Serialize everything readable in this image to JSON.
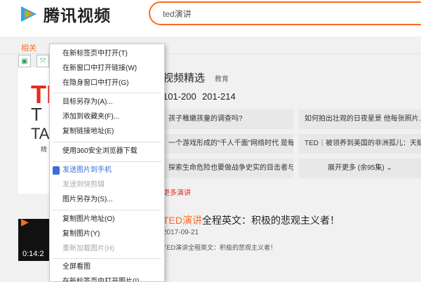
{
  "header": {
    "logo_text": "腾讯视频",
    "search_value": "ted演讲"
  },
  "breadcrumb": "相关",
  "card": {
    "letters_red": "TE",
    "letters_dark": "T",
    "letters_dark2": "TA",
    "small_text": "精"
  },
  "section": {
    "title": "视频精选",
    "tag": "教育",
    "ranges": [
      "101-200",
      "201-214"
    ],
    "tiles": [
      [
        "孩子稚嫩孩童的调查吗?",
        "如何拍出壮观的日夜星景 他每张照片..."
      ],
      [
        "一个游戏形成的\"千人千面\"网络时代 是每个人...",
        "TED｜被领养到美国的非洲孤儿：天赋..."
      ],
      [
        "探索生命危险也要做战争史实的目击者与中...",
        ""
      ]
    ],
    "expand_label": "展开更多 (余95集)",
    "red_link": "更多演讲"
  },
  "video": {
    "time": "0:14:2",
    "title_highlight": "TED演讲",
    "title_rest": "全程英文：积极的悲观主义者！",
    "date": "2017-09-21",
    "desc": "TED演讲全程英文：积极的悲观主义者！"
  },
  "context_menu": {
    "items": [
      {
        "label": "在新标签页中打开(T)",
        "state": "normal"
      },
      {
        "label": "在新窗口中打开链接(W)",
        "state": "normal"
      },
      {
        "label": "在隐身窗口中打开(G)",
        "state": "normal"
      },
      {
        "label": "目标另存为(A)...",
        "state": "normal"
      },
      {
        "label": "添加到收藏夹(F)...",
        "state": "normal"
      },
      {
        "label": "复制链接地址(E)",
        "state": "normal"
      },
      {
        "label": "使用360安全浏览器下载",
        "state": "normal"
      },
      {
        "label": "发送图片到手机",
        "state": "highlight"
      },
      {
        "label": "发送到快剪辑",
        "state": "disabled"
      },
      {
        "label": "图片另存为(S)...",
        "state": "normal"
      },
      {
        "label": "复制图片地址(O)",
        "state": "normal"
      },
      {
        "label": "复制图片(Y)",
        "state": "normal"
      },
      {
        "label": "重新加载图片(H)",
        "state": "disabled"
      },
      {
        "label": "全屏看图",
        "state": "normal"
      },
      {
        "label": "在新标签页中打开图片(I)",
        "state": "normal"
      }
    ]
  }
}
